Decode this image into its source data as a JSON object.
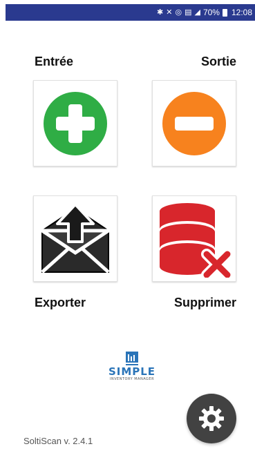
{
  "status_bar": {
    "icons": [
      "bluetooth-icon",
      "mute-icon",
      "alarm-icon",
      "4g-icon",
      "signal-icon",
      "battery-icon"
    ],
    "battery": "70%",
    "time": "12:08",
    "color": "#2a3a8f"
  },
  "main": {
    "entry_label": "Entrée",
    "exit_label": "Sortie",
    "export_label": "Exporter",
    "delete_label": "Supprimer"
  },
  "colors": {
    "entry": "#2fad45",
    "exit": "#f7821e",
    "delete": "#d8262c",
    "settings": "#424242"
  },
  "logo": {
    "title": "SIMPLE",
    "subtitle": "INVENTORY MANAGER"
  },
  "footer": {
    "version": "SoltiScan v. 2.4.1"
  }
}
